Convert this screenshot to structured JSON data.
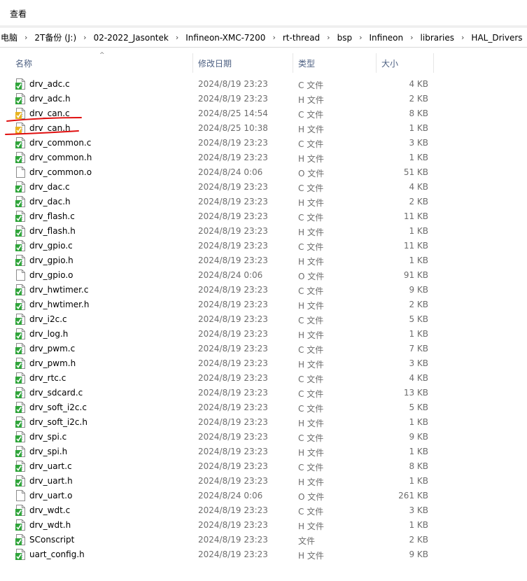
{
  "ribbon": {
    "view_tab": "查看"
  },
  "address": {
    "crumbs": [
      "电脑",
      "2T备份 (J:)",
      "02-2022_Jasontek",
      "Infineon-XMC-7200",
      "rt-thread",
      "bsp",
      "Infineon",
      "libraries",
      "HAL_Drivers"
    ]
  },
  "columns": {
    "name": "名称",
    "date": "修改日期",
    "type": "类型",
    "size": "大小"
  },
  "files": [
    {
      "name": "drv_adc.c",
      "date": "2024/8/19 23:23",
      "type": "C 文件",
      "size": "4 KB",
      "icon": "source-file-icon"
    },
    {
      "name": "drv_adc.h",
      "date": "2024/8/19 23:23",
      "type": "H 文件",
      "size": "2 KB",
      "icon": "source-file-icon"
    },
    {
      "name": "drv_can.c",
      "date": "2024/8/25 14:54",
      "type": "C 文件",
      "size": "8 KB",
      "icon": "modified-source-file-icon"
    },
    {
      "name": "drv_can.h",
      "date": "2024/8/25 10:38",
      "type": "H 文件",
      "size": "1 KB",
      "icon": "modified-source-file-icon"
    },
    {
      "name": "drv_common.c",
      "date": "2024/8/19 23:23",
      "type": "C 文件",
      "size": "3 KB",
      "icon": "source-file-icon"
    },
    {
      "name": "drv_common.h",
      "date": "2024/8/19 23:23",
      "type": "H 文件",
      "size": "1 KB",
      "icon": "source-file-icon"
    },
    {
      "name": "drv_common.o",
      "date": "2024/8/24 0:06",
      "type": "O 文件",
      "size": "51 KB",
      "icon": "blank-file-icon"
    },
    {
      "name": "drv_dac.c",
      "date": "2024/8/19 23:23",
      "type": "C 文件",
      "size": "4 KB",
      "icon": "source-file-icon"
    },
    {
      "name": "drv_dac.h",
      "date": "2024/8/19 23:23",
      "type": "H 文件",
      "size": "2 KB",
      "icon": "source-file-icon"
    },
    {
      "name": "drv_flash.c",
      "date": "2024/8/19 23:23",
      "type": "C 文件",
      "size": "11 KB",
      "icon": "source-file-icon"
    },
    {
      "name": "drv_flash.h",
      "date": "2024/8/19 23:23",
      "type": "H 文件",
      "size": "1 KB",
      "icon": "source-file-icon"
    },
    {
      "name": "drv_gpio.c",
      "date": "2024/8/19 23:23",
      "type": "C 文件",
      "size": "11 KB",
      "icon": "source-file-icon"
    },
    {
      "name": "drv_gpio.h",
      "date": "2024/8/19 23:23",
      "type": "H 文件",
      "size": "1 KB",
      "icon": "source-file-icon"
    },
    {
      "name": "drv_gpio.o",
      "date": "2024/8/24 0:06",
      "type": "O 文件",
      "size": "91 KB",
      "icon": "blank-file-icon"
    },
    {
      "name": "drv_hwtimer.c",
      "date": "2024/8/19 23:23",
      "type": "C 文件",
      "size": "9 KB",
      "icon": "source-file-icon"
    },
    {
      "name": "drv_hwtimer.h",
      "date": "2024/8/19 23:23",
      "type": "H 文件",
      "size": "2 KB",
      "icon": "source-file-icon"
    },
    {
      "name": "drv_i2c.c",
      "date": "2024/8/19 23:23",
      "type": "C 文件",
      "size": "5 KB",
      "icon": "source-file-icon"
    },
    {
      "name": "drv_log.h",
      "date": "2024/8/19 23:23",
      "type": "H 文件",
      "size": "1 KB",
      "icon": "source-file-icon"
    },
    {
      "name": "drv_pwm.c",
      "date": "2024/8/19 23:23",
      "type": "C 文件",
      "size": "7 KB",
      "icon": "source-file-icon"
    },
    {
      "name": "drv_pwm.h",
      "date": "2024/8/19 23:23",
      "type": "H 文件",
      "size": "3 KB",
      "icon": "source-file-icon"
    },
    {
      "name": "drv_rtc.c",
      "date": "2024/8/19 23:23",
      "type": "C 文件",
      "size": "4 KB",
      "icon": "source-file-icon"
    },
    {
      "name": "drv_sdcard.c",
      "date": "2024/8/19 23:23",
      "type": "C 文件",
      "size": "13 KB",
      "icon": "source-file-icon"
    },
    {
      "name": "drv_soft_i2c.c",
      "date": "2024/8/19 23:23",
      "type": "C 文件",
      "size": "5 KB",
      "icon": "source-file-icon"
    },
    {
      "name": "drv_soft_i2c.h",
      "date": "2024/8/19 23:23",
      "type": "H 文件",
      "size": "1 KB",
      "icon": "source-file-icon"
    },
    {
      "name": "drv_spi.c",
      "date": "2024/8/19 23:23",
      "type": "C 文件",
      "size": "9 KB",
      "icon": "source-file-icon"
    },
    {
      "name": "drv_spi.h",
      "date": "2024/8/19 23:23",
      "type": "H 文件",
      "size": "1 KB",
      "icon": "source-file-icon"
    },
    {
      "name": "drv_uart.c",
      "date": "2024/8/19 23:23",
      "type": "C 文件",
      "size": "8 KB",
      "icon": "source-file-icon"
    },
    {
      "name": "drv_uart.h",
      "date": "2024/8/19 23:23",
      "type": "H 文件",
      "size": "1 KB",
      "icon": "source-file-icon"
    },
    {
      "name": "drv_uart.o",
      "date": "2024/8/24 0:06",
      "type": "O 文件",
      "size": "261 KB",
      "icon": "blank-file-icon"
    },
    {
      "name": "drv_wdt.c",
      "date": "2024/8/19 23:23",
      "type": "C 文件",
      "size": "3 KB",
      "icon": "source-file-icon"
    },
    {
      "name": "drv_wdt.h",
      "date": "2024/8/19 23:23",
      "type": "H 文件",
      "size": "1 KB",
      "icon": "source-file-icon"
    },
    {
      "name": "SConscript",
      "date": "2024/8/19 23:23",
      "type": "文件",
      "size": "2 KB",
      "icon": "source-file-icon"
    },
    {
      "name": "uart_config.h",
      "date": "2024/8/19 23:23",
      "type": "H 文件",
      "size": "9 KB",
      "icon": "source-file-icon"
    }
  ],
  "colors": {
    "check_green": "#2fa43a",
    "modified_yellow": "#e8b420",
    "annotation_red": "#e01010",
    "header_text": "#4d6082"
  }
}
